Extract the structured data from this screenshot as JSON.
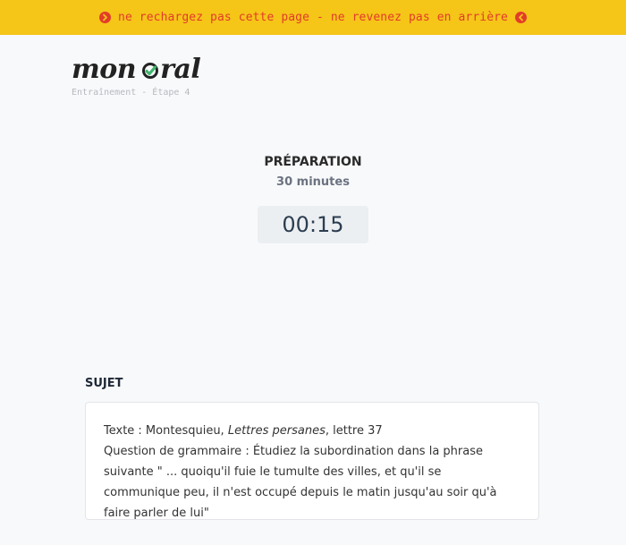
{
  "banner": {
    "text": "ne rechargez pas cette page - ne revenez pas en arrière",
    "color": "#e23c2a",
    "background": "#f5c518",
    "left_icon": "chevron-right-circle-icon",
    "right_icon": "chevron-left-circle-icon"
  },
  "logo": {
    "part1": "mon",
    "part2": "ral",
    "check_color": "#3fb56b"
  },
  "step_label": "Entraînement - Étape 4",
  "preparation": {
    "title": "PRÉPARATION",
    "duration": "30 minutes",
    "timer": "00:15"
  },
  "subject": {
    "heading": "SUJET",
    "text_prefix": "Texte : Montesquieu, ",
    "text_work": "Lettres persanes",
    "text_suffix": ", lettre 37",
    "question": "Question de grammaire : Étudiez la subordination dans la phrase suivante \" ... quoiqu'il fuie le tumulte des villes, et qu'il se communique peu, il n'est occupé depuis le matin jusqu'au soir qu'à faire parler de lui\""
  }
}
